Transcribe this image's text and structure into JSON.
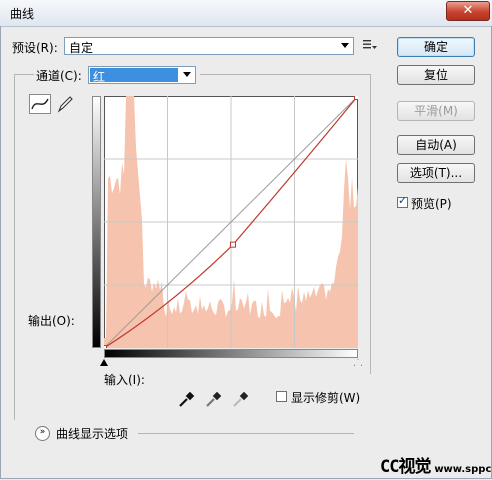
{
  "window": {
    "title": "曲线",
    "close_glyph": "✕"
  },
  "preset": {
    "label": "预设(R):",
    "value": "自定"
  },
  "channel": {
    "label": "通道(C):",
    "value": "红"
  },
  "output_label": "输出(O):",
  "input_label": "输入(I):",
  "buttons": {
    "ok": "确定",
    "reset": "复位",
    "smooth": "平滑(M)",
    "auto": "自动(A)",
    "options": "选项(T)..."
  },
  "preview": {
    "label": "预览(P)",
    "checked": true
  },
  "show_clipping": {
    "label": "显示修剪(W)",
    "checked": false
  },
  "display_options": {
    "label": "曲线显示选项"
  },
  "watermark": {
    "main": "CC视觉",
    "sub": "www.sppc.cc"
  },
  "colors": {
    "histogram": "#f6c3ae",
    "curve": "#c0392b",
    "channel_highlight": "#3d8fe0"
  },
  "curve": {
    "points": [
      [
        0,
        0
      ],
      [
        130,
        105
      ],
      [
        255,
        255
      ]
    ],
    "range": [
      0,
      255
    ]
  }
}
